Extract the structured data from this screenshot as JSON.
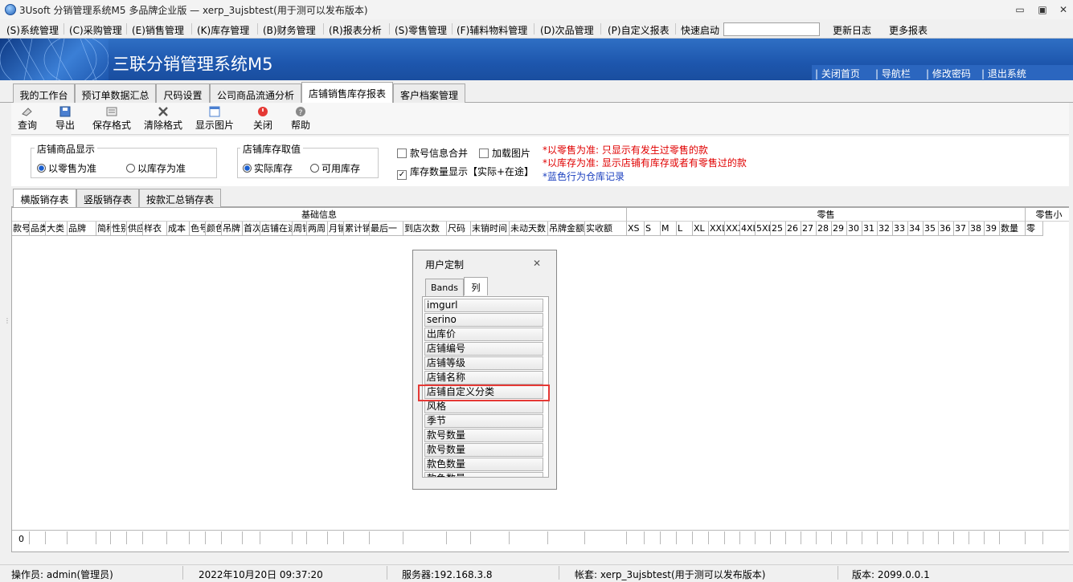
{
  "window": {
    "title": "3Usoft 分销管理系统M5 多品牌企业版 — xerp_3ujsbtest(用于测可以发布版本)",
    "min": "▭",
    "max": "▣",
    "close": "✕"
  },
  "menu": {
    "items": [
      "(S)系统管理",
      "(C)采购管理",
      "(E)销售管理",
      "(K)库存管理",
      "(B)财务管理",
      "(R)报表分析",
      "(S)零售管理",
      "(F)辅料物料管理",
      "(D)次品管理",
      "(P)自定义报表"
    ],
    "quick_label": "快速启动",
    "quick_value": "",
    "log": "更新日志",
    "more": "更多报表"
  },
  "banner": {
    "title": "三联分销管理系统M5",
    "links": [
      "| 关闭首页",
      "| 导航栏",
      "| 修改密码",
      "| 退出系统"
    ]
  },
  "tabs": [
    "我的工作台",
    "预订单数据汇总",
    "尺码设置",
    "公司商品流通分析",
    "店铺销售库存报表",
    "客户档案管理"
  ],
  "toolbar": {
    "query": "查询",
    "export": "导出",
    "save_format": "保存格式",
    "clear_format": "清除格式",
    "show_image": "显示图片",
    "close": "关闭",
    "help": "帮助"
  },
  "filters": {
    "display": {
      "title": "店铺商品显示",
      "opt1": "以零售为准",
      "opt2": "以库存为准"
    },
    "stock": {
      "title": "店铺库存取值",
      "opt1": "实际库存",
      "opt2": "可用库存"
    },
    "merge": "款号信息合并",
    "load_image": "加载图片",
    "stock_qty": "库存数量显示【实际+在途】",
    "notes": [
      "*以零售为准: 只显示有发生过零售的款",
      "*以库存为准: 显示店铺有库存或者有零售过的款",
      "*蓝色行为仓库记录"
    ],
    "colors": {
      "red": "#e00000",
      "blue": "#1a3fbf"
    }
  },
  "subtabs": [
    "横版销存表",
    "竖版销存表",
    "按款汇总销存表"
  ],
  "grid": {
    "bands": [
      "基础信息",
      "零售",
      "零售小"
    ],
    "base_cols": [
      "款号",
      "品类",
      "大类",
      "品牌",
      "简称",
      "性别",
      "供应",
      "样衣",
      "成本",
      "色号",
      "颜色",
      "吊牌",
      "首次",
      "店铺在途",
      "周销",
      "两周",
      "月销",
      "累计销",
      "最后一",
      "到店次数",
      "尺码",
      "末销时间",
      "未动天数",
      "吊牌金额",
      "实收额"
    ],
    "size_cols": [
      "XS",
      "S",
      "M",
      "L",
      "XL",
      "XXL",
      "XXXL",
      "4XL",
      "5XL",
      "25",
      "26",
      "27",
      "28",
      "29",
      "30",
      "31",
      "32",
      "33",
      "34",
      "35",
      "36",
      "37",
      "38",
      "39",
      "数量",
      "零"
    ],
    "footer_count": "0"
  },
  "dialog": {
    "title": "用户定制",
    "close": "✕",
    "tab_bands": "Bands",
    "tab_cols": "列",
    "items": [
      "imgurl",
      "serino",
      "出库价",
      "店铺编号",
      "店铺等级",
      "店铺名称",
      "店铺自定义分类",
      "风格",
      "季节",
      "款号数量",
      "款号数量",
      "款色数量",
      "款色数量"
    ]
  },
  "status": {
    "operator": "操作员: admin(管理员)",
    "datetime": "2022年10月20日 09:37:20",
    "server": "服务器:192.168.3.8",
    "account": "帐套: xerp_3ujsbtest(用于测可以发布版本)",
    "version": "版本: 2099.0.0.1"
  }
}
